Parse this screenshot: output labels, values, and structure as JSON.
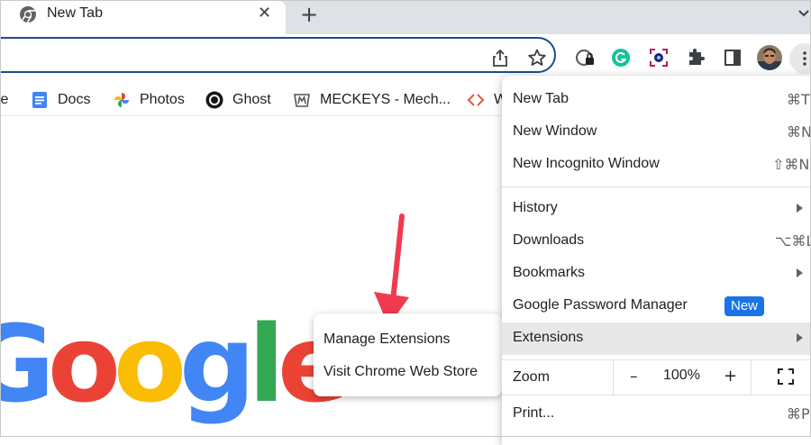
{
  "tab": {
    "title": "New Tab",
    "close_glyph": "✕"
  },
  "newtab_glyph": "+",
  "bookmarks": [
    {
      "label": "te",
      "icon": "partial-bookmark"
    },
    {
      "label": "Docs",
      "icon": "docs-icon"
    },
    {
      "label": "Photos",
      "icon": "photos-icon"
    },
    {
      "label": "Ghost",
      "icon": "ghost-icon"
    },
    {
      "label": "MECKEYS - Mech...",
      "icon": "meckeys-icon"
    },
    {
      "label": "W",
      "icon": "code-brackets-icon"
    }
  ],
  "logo": {
    "letters": [
      "o",
      "o",
      "g",
      "l",
      "e"
    ],
    "colors": [
      "#EA4335",
      "#FBBC05",
      "#4285F4",
      "#34A853",
      "#EA4335"
    ],
    "partial_letter": "G"
  },
  "submenu": {
    "items": [
      "Manage Extensions",
      "Visit Chrome Web Store"
    ]
  },
  "menu": {
    "new_tab": {
      "label": "New Tab",
      "shortcut": "⌘T"
    },
    "new_window": {
      "label": "New Window",
      "shortcut": "⌘N"
    },
    "new_incognito": {
      "label": "New Incognito Window",
      "shortcut": "⇧⌘N"
    },
    "history": {
      "label": "History"
    },
    "downloads": {
      "label": "Downloads",
      "shortcut": "⌥⌘L"
    },
    "bookmarks": {
      "label": "Bookmarks"
    },
    "password_manager": {
      "label": "Google Password Manager",
      "badge": "New"
    },
    "extensions": {
      "label": "Extensions"
    },
    "zoom": {
      "label": "Zoom",
      "minus": "–",
      "value": "100%",
      "plus": "+"
    },
    "print": {
      "label": "Print...",
      "shortcut": "⌘P"
    }
  },
  "colors": {
    "omnibox_border": "#1a4d8f",
    "arrow": "#f03a4f",
    "badge": "#1a73e8",
    "highlight": "#e8e8e8"
  }
}
